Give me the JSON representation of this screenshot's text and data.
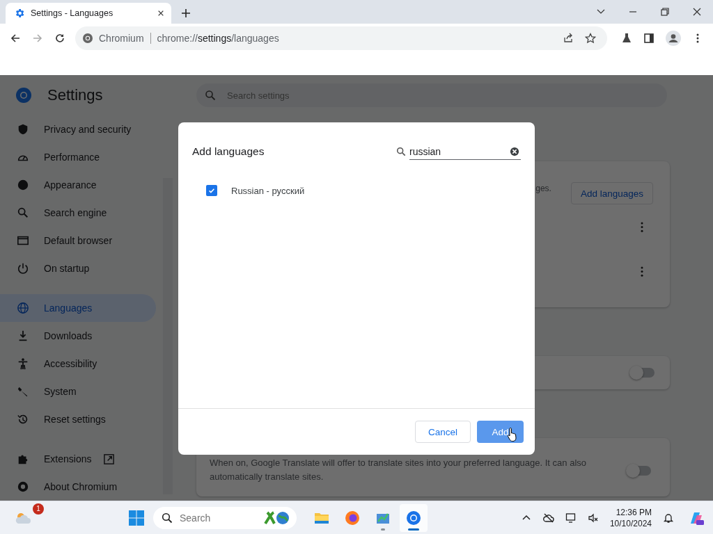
{
  "browser": {
    "tab": {
      "title": "Settings - Languages",
      "selected": true
    },
    "address": {
      "site": "Chromium",
      "url_scheme": "chrome://",
      "url_host": "settings",
      "url_path": "/languages"
    }
  },
  "settings": {
    "title": "Settings",
    "search": {
      "placeholder": "Search settings"
    },
    "sidebar": [
      [
        {
          "label": "Privacy and security",
          "selected": false,
          "external": false
        },
        {
          "label": "Performance",
          "selected": false,
          "external": false
        },
        {
          "label": "Appearance",
          "selected": false,
          "external": false
        },
        {
          "label": "Search engine",
          "selected": false,
          "external": false
        },
        {
          "label": "Default browser",
          "selected": false,
          "external": false
        },
        {
          "label": "On startup",
          "selected": false,
          "external": false
        }
      ],
      [
        {
          "label": "Languages",
          "selected": true,
          "external": false
        },
        {
          "label": "Downloads",
          "selected": false,
          "external": false
        },
        {
          "label": "Accessibility",
          "selected": false,
          "external": false
        },
        {
          "label": "System",
          "selected": false,
          "external": false
        },
        {
          "label": "Reset settings",
          "selected": false,
          "external": false
        }
      ],
      [
        {
          "label": "Extensions",
          "selected": false,
          "external": true
        },
        {
          "label": "About Chromium",
          "selected": false,
          "external": false
        }
      ]
    ],
    "languages_card": {
      "text_fragment": "ges.",
      "button": "Add languages",
      "rows": [
        {
          "kind": "language"
        },
        {
          "kind": "language"
        }
      ]
    },
    "toggle_card": {
      "on": false
    },
    "translate_card": {
      "description": "When on, Google Translate will offer to translate sites into your preferred language. It can also automatically translate sites.",
      "on": false
    }
  },
  "dialog": {
    "title": "Add languages",
    "search": {
      "value": "russian"
    },
    "languages": [
      {
        "label": "Russian - русский",
        "checked": true
      }
    ],
    "buttons": [
      {
        "label": "Cancel",
        "kind": "secondary"
      },
      {
        "label": "Add",
        "kind": "primary"
      }
    ]
  },
  "taskbar": {
    "weather_badge": "1",
    "search": {
      "placeholder": "Search"
    },
    "apps": [
      {
        "running": false,
        "selected": false
      },
      {
        "running": false,
        "selected": false
      },
      {
        "running": true,
        "selected": false
      },
      {
        "running": true,
        "selected": true
      }
    ],
    "time": "12:36 PM",
    "date": "10/10/2024"
  }
}
